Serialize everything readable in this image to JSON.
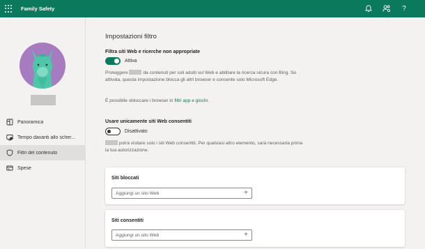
{
  "topbar": {
    "app_title": "Family Safety",
    "icons": [
      "waffle-icon",
      "bell-icon",
      "people-settings-icon",
      "help-icon"
    ],
    "help_glyph": "?"
  },
  "sidebar": {
    "items": [
      {
        "label": "Panoramica",
        "icon": "overview-icon",
        "active": false
      },
      {
        "label": "Tempo davanti allo scher...",
        "icon": "screen-time-icon",
        "active": false
      },
      {
        "label": "Filtri del contenuto",
        "icon": "shield-icon",
        "active": true
      },
      {
        "label": "Spese",
        "icon": "spending-icon",
        "active": false
      }
    ]
  },
  "main": {
    "title": "Impostazioni filtro",
    "filter_section": {
      "title": "Filtra siti Web e ricerche non appropriate",
      "toggle_label": "Attiva",
      "toggle_on": true,
      "desc_part1": "Proteggere",
      "desc_part2": "da contenuti per soli adulti sul Web e abilitare la ricerca sicura con Bing. Se attivata, questa impostazione blocca gli altri browser e consente solo Microsoft Edge.",
      "unblock_text": "È possibile sbloccare i browser in",
      "unblock_link": "filtri app e giochi",
      "unblock_end": "."
    },
    "allowed_only_section": {
      "title": "Usare unicamente siti Web consentiti",
      "toggle_label": "Disattivato",
      "toggle_on": false,
      "desc": "potrà visitare solo i siti Web consentiti. Per qualsiasi altro elemento, sarà necessaria prima la tua autorizzazione."
    },
    "blocked_card": {
      "title": "Siti bloccati",
      "placeholder": "Aggiungi un sito Web",
      "add_glyph": "+"
    },
    "allowed_card": {
      "title": "Siti consentiti",
      "placeholder": "Aggiungi un sito Web",
      "add_glyph": "+"
    }
  },
  "colors": {
    "brand": "#0b7a5c",
    "avatar_bg": "#a77bc0",
    "llama": "#4fc6a8"
  }
}
